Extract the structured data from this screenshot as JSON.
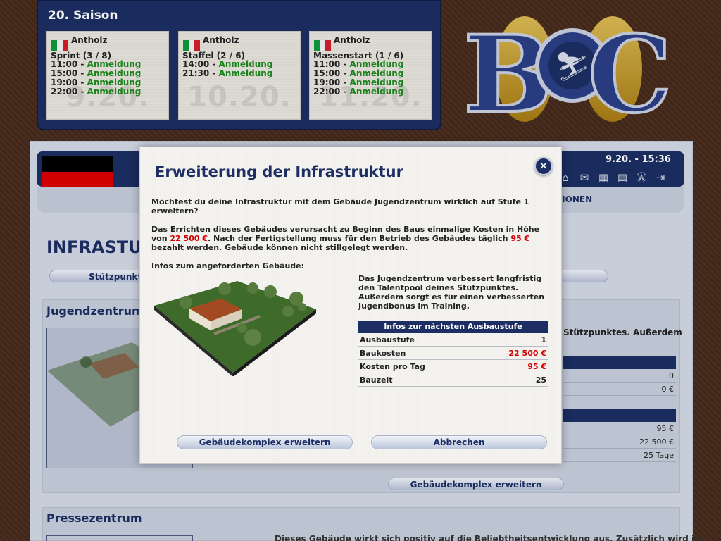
{
  "season": {
    "title": "20. Saison",
    "races": [
      {
        "venue": "Antholz",
        "race": "Sprint (3 / 8)",
        "date": "9.20.",
        "slots": [
          {
            "time": "11:00",
            "label": "Anmeldung"
          },
          {
            "time": "15:00",
            "label": "Anmeldung"
          },
          {
            "time": "19:00",
            "label": "Anmeldung"
          },
          {
            "time": "22:00",
            "label": "Anmeldung"
          }
        ]
      },
      {
        "venue": "Antholz",
        "race": "Staffel (2 / 6)",
        "date": "10.20.",
        "slots": [
          {
            "time": "14:00",
            "label": "Anmeldung"
          },
          {
            "time": "21:30",
            "label": "Anmeldung"
          }
        ]
      },
      {
        "venue": "Antholz",
        "race": "Massenstart (1 / 6)",
        "date": "11.20.",
        "slots": [
          {
            "time": "11:00",
            "label": "Anmeldung"
          },
          {
            "time": "15:00",
            "label": "Anmeldung"
          },
          {
            "time": "19:00",
            "label": "Anmeldung"
          },
          {
            "time": "22:00",
            "label": "Anmeldung"
          }
        ]
      }
    ]
  },
  "logo": {
    "text": "BOC"
  },
  "header": {
    "datetime": "9.20. - 15:36",
    "tab_options": "TIONEN"
  },
  "page": {
    "heading": "INFRASTU",
    "subnav_left": "Stützpunktin",
    "section1_title": "Jugendzentrum",
    "section1_desc": "Stützpunktes. Außerdem",
    "section1_rows": [
      "0",
      "0 €",
      "95 €",
      "22 500 €",
      "25 Tage"
    ],
    "section1_button": "Gebäudekomplex erweitern",
    "section2_title": "Pressezentrum",
    "section2_text": "Dieses Gebäude wirkt sich positiv auf die Beliebtheitsentwicklung aus. Zusätzlich wird im"
  },
  "modal": {
    "title": "Erweiterung der Infrastruktur",
    "question": "Möchtest du deine Infrastruktur mit dem Gebäude Jugendzentrum wirklich auf Stufe 1 erweitern?",
    "costs_1": "Das Errichten dieses Gebäudes verursacht zu Beginn des Baus einmalige Kosten in Höhe von",
    "costs_amount": "22 500 €",
    "costs_2": ". Nach der Fertigstellung muss für den Betrieb des Gebäudes täglich",
    "daily_amount": "95 €",
    "costs_3": "bezahlt werden. Gebäude können nicht stillgelegt werden.",
    "infos_label": "Infos zum angeforderten Gebäude:",
    "description": "Das Jugendzentrum verbessert langfristig den Talentpool deines Stützpunktes. Außerdem sorgt es für einen verbesserten Jugendbonus im Training.",
    "table": {
      "header": "Infos zur nächsten Ausbaustufe",
      "rows": [
        {
          "label": "Ausbaustufe",
          "value": "1"
        },
        {
          "label": "Baukosten",
          "value": "22 500 €"
        },
        {
          "label": "Kosten pro Tag",
          "value": "95 €"
        },
        {
          "label": "Bauzeit",
          "value": "25"
        }
      ]
    },
    "btn_expand": "Gebäudekomplex erweitern",
    "btn_cancel": "Abbrechen"
  },
  "colors": {
    "navy": "#1c2e63",
    "register_green": "#1b8a1b",
    "cost_red": "#d40000"
  },
  "icons": [
    "home-icon",
    "mail-icon",
    "calendar-icon",
    "chart-icon",
    "wiki-icon",
    "logout-icon"
  ]
}
